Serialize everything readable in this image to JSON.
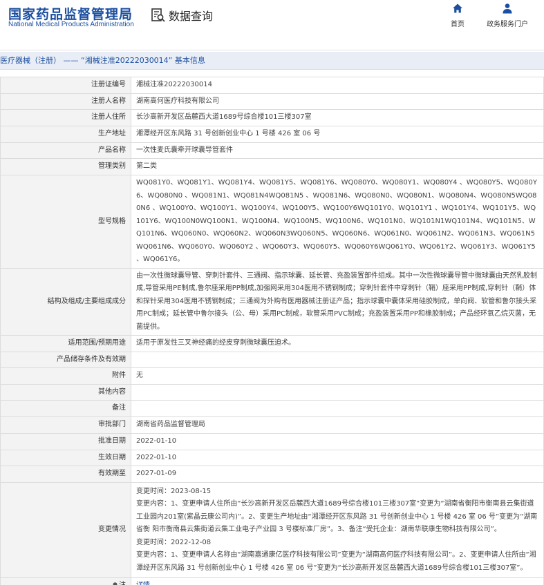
{
  "header": {
    "logo_cn": "国家药品监督管理局",
    "logo_en": "National Medical Products Administration",
    "query_title": "数据查询",
    "nav_home": "首页",
    "nav_gov": "政务服务门户"
  },
  "breadcrumb": {
    "category": "医疗器械（注册）",
    "separator": "——",
    "record": "“湘械注准20222030014”",
    "suffix": "基本信息"
  },
  "rows": [
    {
      "label": "注册证编号",
      "value": "湘械注准20222030014"
    },
    {
      "label": "注册人名称",
      "value": "湖南高何医疗科技有限公司"
    },
    {
      "label": "注册人住所",
      "value": "长沙高新开发区岳麓西大道1689号综合楼101三楼307室"
    },
    {
      "label": "生产地址",
      "value": "湘潭经开区东风路 31 号创新创业中心 1 号楼 426 室 06 号"
    },
    {
      "label": "产品名称",
      "value": "一次性麦氏囊牵开球囊导管套件"
    },
    {
      "label": "管理类别",
      "value": "第二类"
    },
    {
      "label": "型号规格",
      "value": "WQ081Y0、WQ081Y1、WQ081Y4、WQ081Y5、WQ081Y6、WQ080Y0、WQ080Y1、WQ080Y4 、WQ080Y5、WQ080Y6、WQ080N0 、WQ081N1、WQ081N4WQ081N5 、WQ081N6、WQ080N0、WQ080N1、WQ080N4、WQ080N5WQ080N6 、WQ100Y0、WQ100Y1、WQ100Y4、WQ100Y5、WQ100Y6WQ101Y0、WQ101Y1 、WQ101Y4、WQ101Y5、WQ101Y6、WQ100N0WQ100N1、WQ100N4、WQ100N5、WQ100N6、WQ101N0、WQ101N1WQ101N4、WQ101N5、WQ101N6、WQ060N0、WQ060N2、WQ060N3WQ060N5、WQ060N6、WQ061N0、WQ061N2、WQ061N3、WQ061N5WQ061N6、WQ060Y0、WQ060Y2 、WQ060Y3、WQ060Y5、WQ060Y6WQ061Y0、WQ061Y2、WQ061Y3、WQ061Y5 、WQ061Y6。"
    },
    {
      "label": "结构及组成/主要组成成分",
      "value": "由一次性微球囊导管、穿刺针套件、三通阀、指示球囊、延长管、充盈装置部件组成。其中一次性微球囊导管中微球囊由天然乳胶制成,导管采用PE制成,鲁尔座采用PP制成,加强网采用304医用不锈钢制成；穿刺针套件中穿刺针（鞘）座采用PP制成,穿刺针（鞘）体和探针采用304医用不锈钢制成；三通阀为外购有医用器械注册证产品；指示球囊中囊体采用硅胶制成，单向阀、软管和鲁尔接头采用PC制成；延长管中鲁尔接头（公、母）采用PC制成，软管采用PVC制成；充盈装置采用PP和橡胶制成；产品经环氧乙烷灭菌，无菌提供。"
    },
    {
      "label": "适用范围/预期用途",
      "value": "适用于原发性三叉神经痛的经皮穿刺微球囊压迫术。"
    },
    {
      "label": "产品储存条件及有效期",
      "value": ""
    },
    {
      "label": "附件",
      "value": "无"
    },
    {
      "label": "其他内容",
      "value": ""
    },
    {
      "label": "备注",
      "value": ""
    },
    {
      "label": "审批部门",
      "value": "湖南省药品监督管理局"
    },
    {
      "label": "批准日期",
      "value": "2022-01-10"
    },
    {
      "label": "生效日期",
      "value": "2022-01-10"
    },
    {
      "label": "有效期至",
      "value": "2027-01-09"
    },
    {
      "label": "变更情况",
      "value": "变更时间：2023-08-15\n变更内容：1、变更申请人住所由“长沙高新开发区岳麓西大道1689号综合楼101三楼307室”变更为“湖南省衡阳市衡南县云集街道工业园内201室(紫晶云康公司内)”。2、变更生产地址由“湘潭经开区东风路 31 号创新创业中心 1 号楼 426 室 06 号”变更为“湖南省衡 阳市衡南县云集街道云集工业电子产业园 3 号楼标准厂房”。3、备注“受托企业：湖南华联康生物科技有限公司”。\n变更时间：2022-12-08\n变更内容：1、变更申请人名称由“湖南嘉通康亿医疗科技有限公司”变更为“湖南高何医疗科技有限公司”。2、变更申请人住所由“湘潭经开区东风路 31 号创新创业中心 1 号楼 426 室 06 号”变更为“长沙高新开发区岳麓西大道1689号综合楼101三楼307室”。"
    },
    {
      "label": "注",
      "value": "详情"
    }
  ],
  "colors": {
    "brand_blue": "#1c4fa0",
    "titlebar_bg": "#e9eef6",
    "label_bg": "#f3f3f3",
    "border": "#dcdcdc"
  },
  "icons": [
    "data-query-icon",
    "home-icon",
    "user-icon",
    "pin-icon"
  ]
}
